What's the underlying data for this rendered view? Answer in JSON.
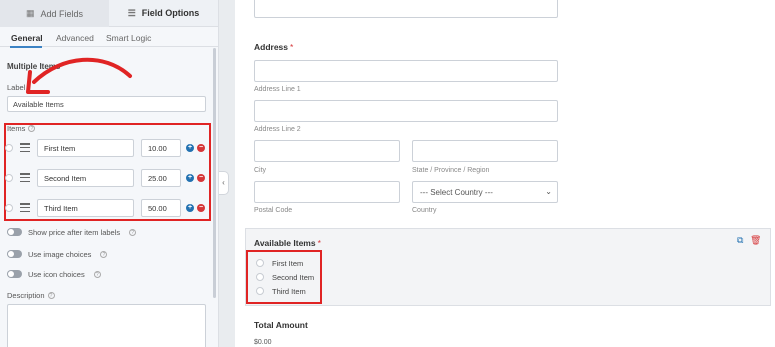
{
  "tabs": [
    {
      "label": "Add Fields",
      "icon": "table-icon"
    },
    {
      "label": "Field Options",
      "icon": "sliders-icon"
    }
  ],
  "subtabs": [
    "General",
    "Advanced",
    "Smart Logic"
  ],
  "field_options": {
    "section_title": "Multiple Items",
    "label_label": "Label",
    "label_value": "Available Items",
    "items_label": "Items",
    "items": [
      {
        "name": "First Item",
        "price": "10.00"
      },
      {
        "name": "Second Item",
        "price": "25.00"
      },
      {
        "name": "Third Item",
        "price": "50.00"
      }
    ],
    "toggles": [
      "Show price after item labels",
      "Use image choices",
      "Use icon choices"
    ],
    "description_label": "Description"
  },
  "preview": {
    "address_label": "Address",
    "address_line1": "Address Line 1",
    "address_line2": "Address Line 2",
    "city": "City",
    "state": "State / Province / Region",
    "postal": "Postal Code",
    "country_label": "Country",
    "country_placeholder": "--- Select Country ---",
    "field_title": "Available Items",
    "options": [
      "First Item",
      "Second Item",
      "Third Item"
    ],
    "total_label": "Total Amount",
    "total_value": "$0.00"
  },
  "colors": {
    "highlight": "#e02424",
    "accent": "#2271b1",
    "required": "#d63638"
  }
}
